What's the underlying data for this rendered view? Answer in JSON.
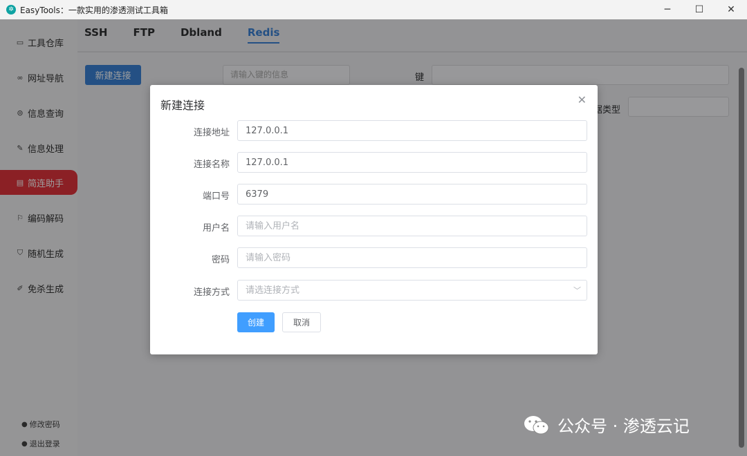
{
  "window": {
    "title": "EasyTools：一款实用的渗透测试工具箱",
    "icon_glyph": "✲",
    "minimize": "─",
    "maximize": "☐",
    "close": "✕"
  },
  "sidebar": {
    "items": [
      {
        "label": "工具仓库",
        "icon": "box-icon",
        "glyph": "▭"
      },
      {
        "label": "网址导航",
        "icon": "link-icon",
        "glyph": "∞"
      },
      {
        "label": "信息查询",
        "icon": "search-doc-icon",
        "glyph": "⊜"
      },
      {
        "label": "信息处理",
        "icon": "edit-icon",
        "glyph": "✎"
      },
      {
        "label": "简连助手",
        "icon": "connect-icon",
        "glyph": "▤"
      },
      {
        "label": "编码解码",
        "icon": "flag-icon",
        "glyph": "⚐"
      },
      {
        "label": "随机生成",
        "icon": "shield-icon",
        "glyph": "⛉"
      },
      {
        "label": "免杀生成",
        "icon": "pen-icon",
        "glyph": "✐"
      }
    ],
    "change_password": "修改密码",
    "logout": "退出登录",
    "user_glyph": "●",
    "logout_glyph": "●"
  },
  "tabs": [
    {
      "label": "SSH"
    },
    {
      "label": "FTP"
    },
    {
      "label": "Dbland"
    },
    {
      "label": "Redis"
    }
  ],
  "main": {
    "new_connection": "新建连接",
    "key_search_placeholder": "请输入键的信息",
    "key_label": "键",
    "data_type_label": "据类型"
  },
  "dialog": {
    "title": "新建连接",
    "close_glyph": "✕",
    "fields": {
      "address": {
        "label": "连接地址",
        "value": "127.0.0.1"
      },
      "name": {
        "label": "连接名称",
        "value": "127.0.0.1"
      },
      "port": {
        "label": "端口号",
        "value": "6379"
      },
      "username": {
        "label": "用户名",
        "placeholder": "请输入用户名"
      },
      "password": {
        "label": "密码",
        "placeholder": "请输入密码"
      },
      "method": {
        "label": "连接方式",
        "placeholder": "请选连接方式"
      }
    },
    "select_arrow": "﹀",
    "create": "创建",
    "cancel": "取消"
  },
  "watermark": {
    "text": "公众号 · 渗透云记"
  }
}
